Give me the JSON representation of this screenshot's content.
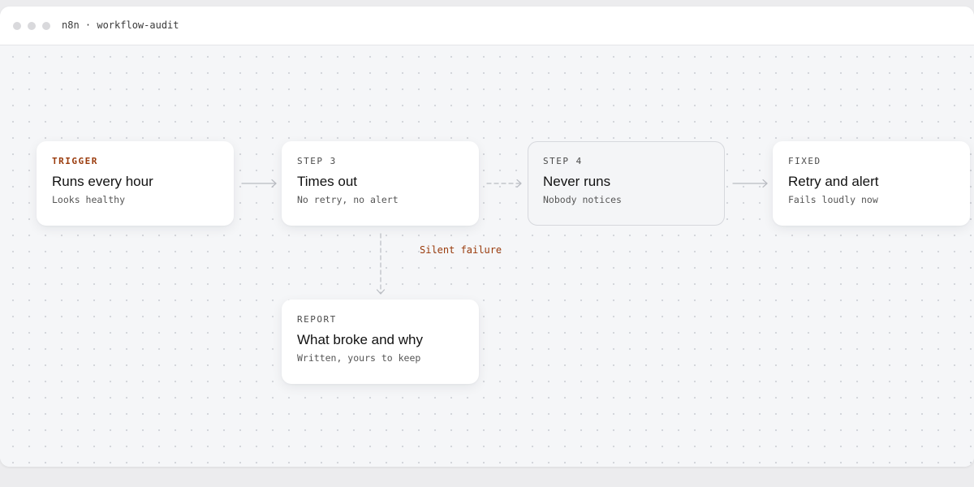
{
  "window": {
    "title": "n8n · workflow-audit"
  },
  "colors": {
    "accent": "#9a3b0c",
    "connector": "#b9bcc2",
    "canvas": "#f5f6f8"
  },
  "nodes": [
    {
      "tag": "TRIGGER",
      "heading": "Runs every hour",
      "sub": "Looks healthy",
      "state": "normal",
      "accent": true
    },
    {
      "tag": "STEP 3",
      "heading": "Times out",
      "sub": "No retry, no alert",
      "state": "normal",
      "accent": false
    },
    {
      "tag": "STEP 4",
      "heading": "Never runs",
      "sub": "Nobody notices",
      "state": "muted",
      "accent": false
    },
    {
      "tag": "FIXED",
      "heading": "Retry and alert",
      "sub": "Fails loudly now",
      "state": "normal",
      "accent": false
    },
    {
      "tag": "REPORT",
      "heading": "What broke and why",
      "sub": "Written, yours to keep",
      "state": "normal",
      "accent": false
    }
  ],
  "annotations": {
    "silent_failure": "Silent failure"
  }
}
